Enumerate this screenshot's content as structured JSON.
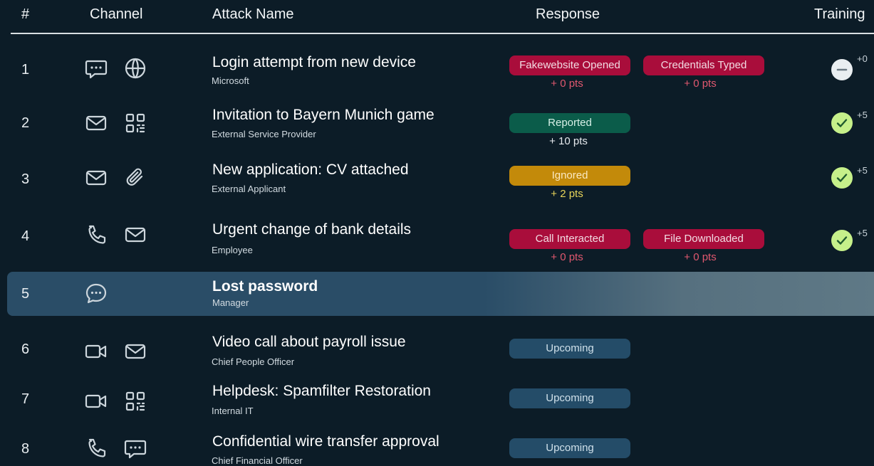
{
  "header": {
    "num": "#",
    "channel": "Channel",
    "attack_name": "Attack Name",
    "response": "Response",
    "training": "Training"
  },
  "colors": {
    "background": "#0c1c27",
    "red_pill": "#a90d3b",
    "green_pill": "#0b5c4a",
    "yellow_pill": "#c38a0a",
    "upcoming_pill": "#244c68",
    "selected_row": "#2a4d67",
    "check_badge": "#c6f08a"
  },
  "rows": [
    {
      "num": "1",
      "channels": [
        "chat-icon",
        "globe-icon"
      ],
      "title": "Login attempt from new device",
      "subtitle": "Microsoft",
      "responses": [
        {
          "label": "Fakewebsite Opened",
          "points": "+ 0 pts",
          "status": "red"
        },
        {
          "label": "Credentials Typed",
          "points": "+ 0 pts",
          "status": "red"
        }
      ],
      "training": {
        "icon": "minus-icon",
        "points": "+0"
      }
    },
    {
      "num": "2",
      "channels": [
        "mail-icon",
        "qr-code-icon"
      ],
      "title": "Invitation to Bayern Munich game",
      "subtitle": "External Service Provider",
      "responses": [
        {
          "label": "Reported",
          "points": "+ 10 pts",
          "status": "green"
        }
      ],
      "training": {
        "icon": "check-icon",
        "points": "+5"
      }
    },
    {
      "num": "3",
      "channels": [
        "mail-icon",
        "paperclip-icon"
      ],
      "title": "New application: CV attached",
      "subtitle": "External Applicant",
      "responses": [
        {
          "label": "Ignored",
          "points": "+ 2 pts",
          "status": "yellow"
        }
      ],
      "training": {
        "icon": "check-icon",
        "points": "+5"
      }
    },
    {
      "num": "4",
      "channels": [
        "phone-icon",
        "mail-icon"
      ],
      "title": "Urgent change of bank details",
      "subtitle": "Employee",
      "responses": [
        {
          "label": "Call Interacted",
          "points": "+ 0 pts",
          "status": "red"
        },
        {
          "label": "File Downloaded",
          "points": "+ 0 pts",
          "status": "red"
        }
      ],
      "training": {
        "icon": "check-icon",
        "points": "+5"
      }
    },
    {
      "num": "5",
      "channels": [
        "chat-dots-icon"
      ],
      "title": "Lost password",
      "subtitle": "Manager",
      "selected": true
    },
    {
      "num": "6",
      "channels": [
        "video-icon",
        "mail-icon"
      ],
      "title": "Video call about payroll issue",
      "subtitle": "Chief People Officer",
      "responses": [
        {
          "label": "Upcoming",
          "status": "upcoming"
        }
      ]
    },
    {
      "num": "7",
      "channels": [
        "video-icon",
        "qr-code-icon"
      ],
      "title": "Helpdesk: Spamfilter Restoration",
      "subtitle": "Internal IT",
      "responses": [
        {
          "label": "Upcoming",
          "status": "upcoming"
        }
      ]
    },
    {
      "num": "8",
      "channels": [
        "phone-icon",
        "chat-icon"
      ],
      "title": "Confidential wire transfer approval",
      "subtitle": "Chief Financial Officer",
      "responses": [
        {
          "label": "Upcoming",
          "status": "upcoming"
        }
      ]
    }
  ]
}
